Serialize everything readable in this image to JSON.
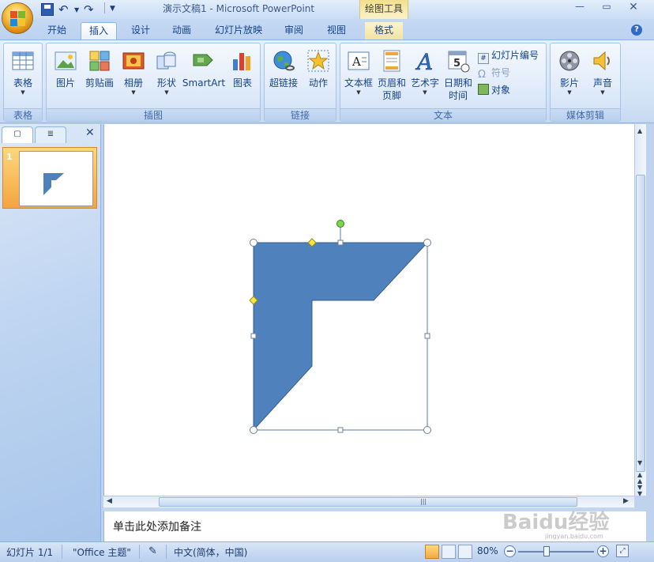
{
  "window": {
    "title": "演示文稿1 - Microsoft PowerPoint",
    "context_tab_group": "绘图工具"
  },
  "quick_access": {
    "icons": [
      "save-icon",
      "undo-icon",
      "redo-icon",
      "customize-icon"
    ]
  },
  "tabs": [
    {
      "label": "开始",
      "active": false
    },
    {
      "label": "插入",
      "active": true
    },
    {
      "label": "设计",
      "active": false
    },
    {
      "label": "动画",
      "active": false
    },
    {
      "label": "幻灯片放映",
      "active": false
    },
    {
      "label": "审阅",
      "active": false
    },
    {
      "label": "视图",
      "active": false
    },
    {
      "label": "格式",
      "active": false
    }
  ],
  "ribbon": {
    "groups": [
      {
        "label": "表格",
        "buttons": [
          "表格"
        ]
      },
      {
        "label": "插图",
        "buttons": [
          "图片",
          "剪贴画",
          "相册",
          "形状",
          "SmartArt",
          "图表"
        ]
      },
      {
        "label": "链接",
        "buttons": [
          "超链接",
          "动作"
        ]
      },
      {
        "label": "文本",
        "buttons": [
          "文本框",
          "页眉和",
          "页脚",
          "艺术字",
          "日期和",
          "时间"
        ],
        "small_buttons": [
          "幻灯片编号",
          "符号",
          "对象"
        ]
      },
      {
        "label": "媒体剪辑",
        "buttons": [
          "影片",
          "声音"
        ]
      }
    ]
  },
  "left_panel": {
    "slide_number": "1"
  },
  "notes": {
    "placeholder": "单击此处添加备注"
  },
  "status": {
    "slide": "幻灯片 1/1",
    "theme": "\"Office 主题\"",
    "language": "中文(简体，中国)",
    "zoom": "80%",
    "zoom_level_percent": 80
  },
  "watermark": {
    "text": "Baidu经验",
    "sub": "jingyan.baidu.com"
  },
  "colors": {
    "shape_fill": "#4f81bd",
    "shape_stroke": "#385d8a",
    "ribbon_bg": "#dbe8f8",
    "accent": "#15428b"
  }
}
